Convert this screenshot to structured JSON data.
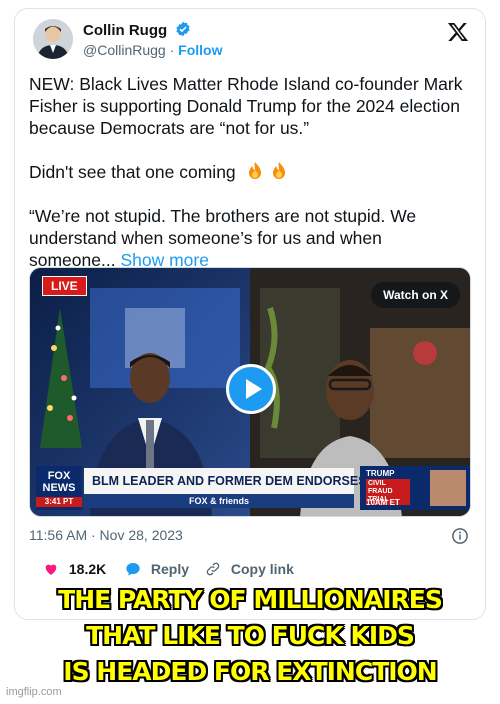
{
  "author": {
    "name": "Collin Rugg",
    "handle": "@CollinRugg",
    "separator": "·",
    "follow_label": "Follow"
  },
  "tweet": {
    "paragraph1": "NEW: Black Lives Matter Rhode Island co-founder Mark Fisher is supporting Donald Trump for the 2024 election because Democrats are “not for us.”",
    "paragraph2": "Didn't see that one coming",
    "paragraph3": "“We’re not stupid. The brothers are not stupid. We understand when someone’s for us and when someone...",
    "show_more": "Show more"
  },
  "media": {
    "watch_label": "Watch on X",
    "live_badge": "LIVE",
    "chyron_main": "BLM LEADER AND FORMER DEM ENDORSES TRUMP",
    "chyron_sub": "FOX & friends",
    "fox_line1": "FOX",
    "fox_line2": "NEWS",
    "fox_time": "3:41 PT",
    "right_line1": "TRUMP",
    "right_line2": "CIVIL FRAUD TRIAL",
    "right_line3": "10AM ET"
  },
  "meta": {
    "timestamp": "11:56 AM · Nov 28, 2023"
  },
  "actions": {
    "likes": "18.2K",
    "reply": "Reply",
    "copy_link": "Copy link"
  },
  "caption": {
    "line1": "THE PARTY OF MILLIONAIRES",
    "line2": "THAT LIKE TO FUCK KIDS",
    "line3": "IS HEADED FOR EXTINCTION"
  },
  "watermark": "imgflip.com",
  "colors": {
    "accent": "#1d9bf0",
    "like": "#f91880",
    "caption_fill": "#ffff00"
  },
  "icons": [
    "verified-badge-icon",
    "x-logo-icon",
    "fire-icon",
    "play-icon",
    "info-icon",
    "heart-icon",
    "reply-icon",
    "link-icon"
  ]
}
